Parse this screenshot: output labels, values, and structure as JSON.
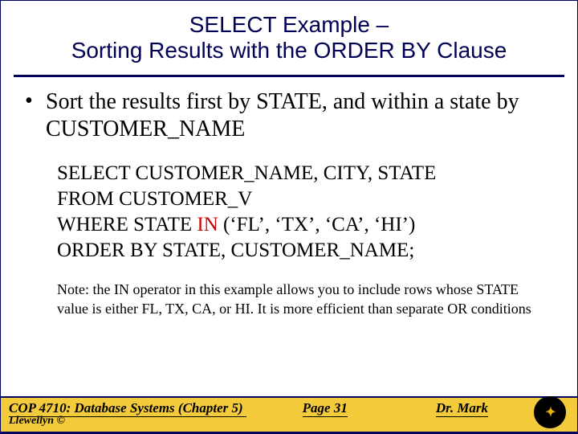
{
  "title": {
    "line1": "SELECT Example –",
    "line2": "Sorting Results with the ORDER BY Clause"
  },
  "bullet": "Sort the results first by STATE, and within a state by CUSTOMER_NAME",
  "code": {
    "l1a": "SELECT CUSTOMER_NAME, CITY, STATE",
    "l2a": "FROM CUSTOMER_V",
    "l3a": "WHERE STATE ",
    "l3kw": "IN",
    "l3b": " (‘FL’, ‘TX’, ‘CA’, ‘HI’)",
    "l4a": "ORDER BY STATE, CUSTOMER_NAME;"
  },
  "note": "Note: the IN operator in this example allows you to include rows whose STATE value is either FL, TX, CA, or HI. It is more efficient than separate OR conditions",
  "footer": {
    "left": "COP 4710: Database Systems  (Chapter 5)",
    "center": "Page 31",
    "right": "Dr. Mark",
    "second": "Llewellyn ©"
  }
}
